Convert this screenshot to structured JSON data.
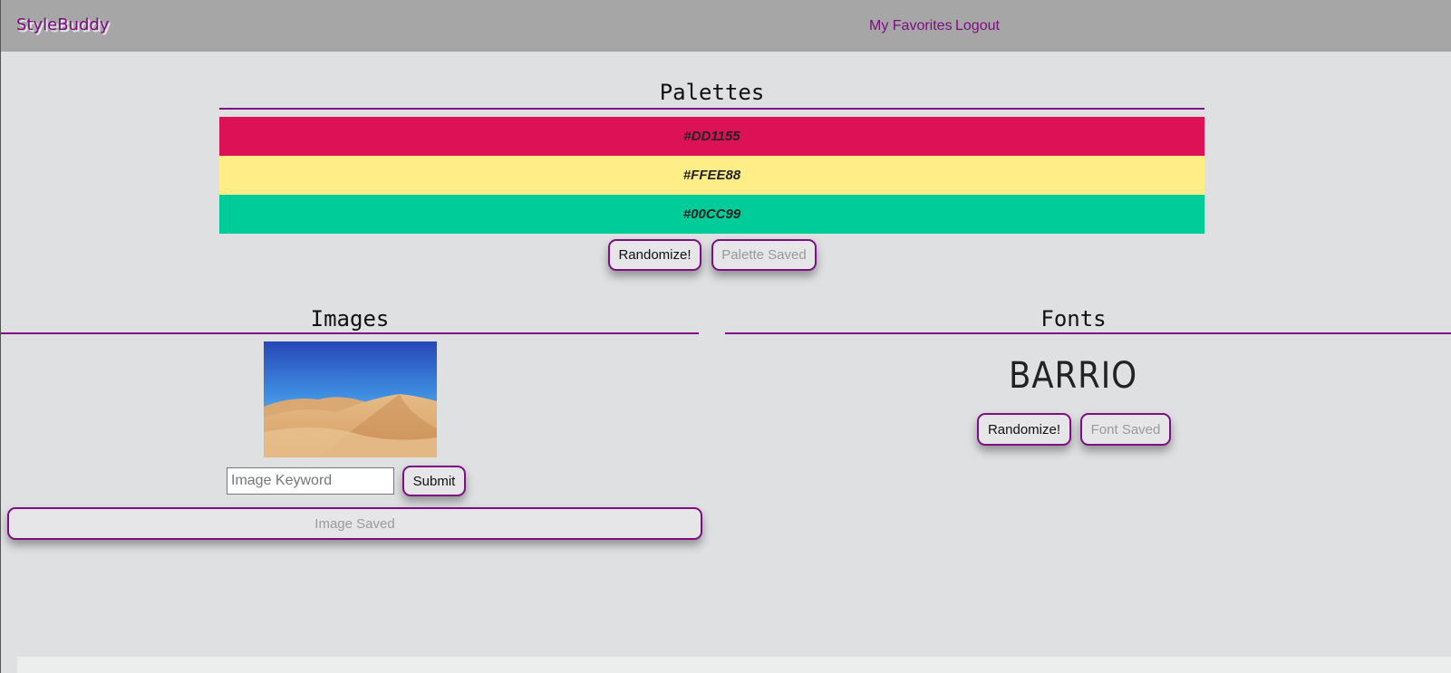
{
  "header": {
    "brand": "StyleBuddy",
    "nav": {
      "favorites": "My Favorites",
      "logout": "Logout"
    }
  },
  "palettes": {
    "title": "Palettes",
    "swatches": [
      {
        "hex": "#DD1155",
        "color": "#dd1155"
      },
      {
        "hex": "#FFEE88",
        "color": "#ffee88"
      },
      {
        "hex": "#00CC99",
        "color": "#00cc99"
      }
    ],
    "randomize_label": "Randomize!",
    "saved_label": "Palette Saved"
  },
  "images": {
    "title": "Images",
    "keyword_placeholder": "Image Keyword",
    "submit_label": "Submit",
    "saved_label": "Image Saved"
  },
  "fonts": {
    "title": "Fonts",
    "sample_text": "BARRIO",
    "randomize_label": "Randomize!",
    "saved_label": "Font Saved"
  }
}
